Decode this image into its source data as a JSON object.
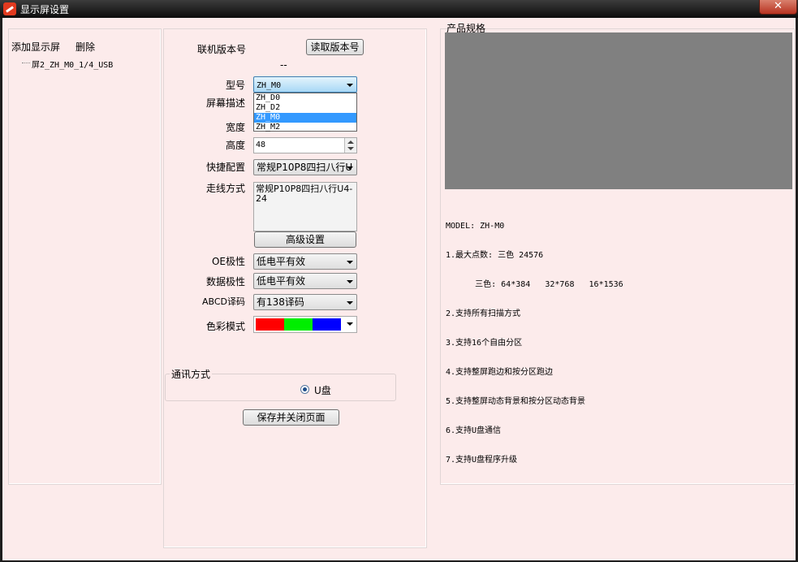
{
  "window": {
    "title": "显示屏设置",
    "close_glyph": "✕"
  },
  "left_panel": {
    "add_label": "添加显示屏",
    "delete_label": "删除",
    "tree_items": [
      "屏2_ZH_M0_1/4_USB"
    ]
  },
  "form": {
    "online_version_label": "联机版本号",
    "read_version_button": "读取版本号",
    "version_value": "--",
    "model_label": "型号",
    "model_selected": "ZH_M0",
    "model_options": [
      "ZH_D0",
      "ZH_D2",
      "ZH_M0",
      "ZH_M2"
    ],
    "screen_desc_label": "屏幕描述",
    "width_label": "宽度",
    "height_label": "高度",
    "height_value": "48",
    "quick_config_label": "快捷配置",
    "quick_config_value": "常规P10P8四扫八行U",
    "wiring_label": "走线方式",
    "wiring_value": "常规P10P8四扫八行U4-24",
    "advanced_button": "高级设置",
    "oe_label": "OE极性",
    "oe_value": "低电平有效",
    "data_polarity_label": "数据极性",
    "data_polarity_value": "低电平有效",
    "abcd_label": "ABCD译码",
    "abcd_value": "有138译码",
    "color_mode_label": "色彩模式",
    "color_swatches": [
      "#ff0000",
      "#00ee00",
      "#0000ff"
    ],
    "comm_group_label": "通讯方式",
    "comm_option": "U盘",
    "save_button": "保存并关闭页面"
  },
  "spec": {
    "title": "产品规格",
    "image_bg": "#808080",
    "lines": [
      "MODEL: ZH-M0",
      "1.最大点数: 三色 24576",
      "      三色: 64*384   32*768   16*1536",
      "2.支持所有扫描方式",
      "3.支持16个自由分区",
      "4.支持整屏跑边和按分区跑边",
      "5.支持整屏动态背景和按分区动态背景",
      "6.支持U盘通信",
      "7.支持U盘程序升级"
    ]
  }
}
